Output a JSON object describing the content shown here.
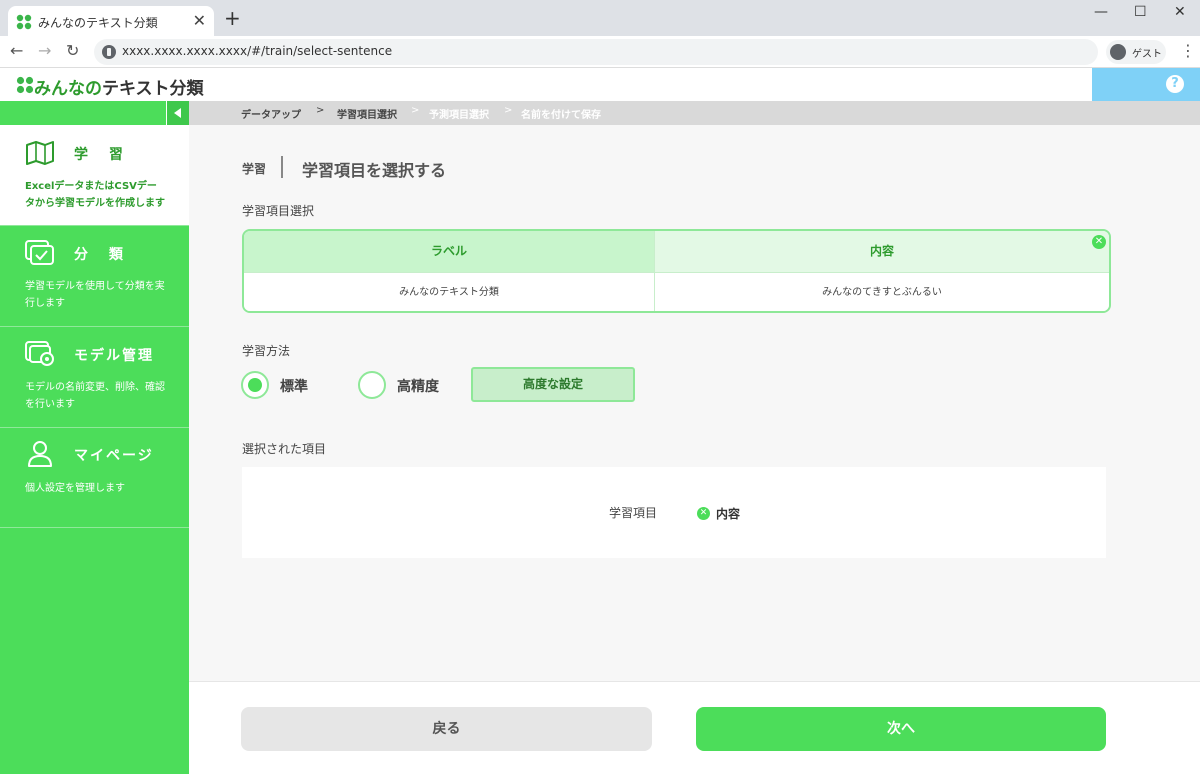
{
  "browser": {
    "tab_title": "みんなのテキスト分類",
    "tab_close": "✕",
    "new_tab": "+",
    "url": "xxxx.xxxx.xxxx.xxxx/#/train/select-sentence",
    "profile_label": "ゲスト",
    "minimize": "—",
    "maximize": "☐",
    "close": "✕",
    "back": "←",
    "forward": "→",
    "reload": "↻",
    "menu": "⋮"
  },
  "app": {
    "logo_hiragana": "みんなの",
    "logo_katakana": "テキスト分類",
    "help": "?"
  },
  "sidebar": {
    "items": [
      {
        "title": "学 習",
        "desc": "ExcelデータまたはCSVデータから学習モデルを作成します",
        "icon": "book-icon"
      },
      {
        "title": "分 類",
        "desc": "学習モデルを使用して分類を実行します",
        "icon": "classify-icon"
      },
      {
        "title": "モデル管理",
        "desc": "モデルの名前変更、削除、確認を行います",
        "icon": "model-settings-icon"
      },
      {
        "title": "マイページ",
        "desc": "個人設定を管理します",
        "icon": "user-icon"
      }
    ]
  },
  "breadcrumb": {
    "steps": [
      "データアップ",
      "学習項目選択",
      "予測項目選択",
      "名前を付けて保存"
    ],
    "sep": ">"
  },
  "page": {
    "section": "学習",
    "title": "学習項目を選択する"
  },
  "select_section": {
    "label": "学習項目選択",
    "columns": [
      {
        "header": "ラベル",
        "value": "みんなのテキスト分類"
      },
      {
        "header": "内容",
        "value": "みんなのてきすとぶんるい"
      }
    ],
    "remove": "✕"
  },
  "method": {
    "label": "学習方法",
    "options": [
      {
        "label": "標準",
        "checked": true
      },
      {
        "label": "高精度",
        "checked": false
      }
    ],
    "advanced": "高度な設定"
  },
  "selected": {
    "label": "選択された項目",
    "key": "学習項目",
    "value": "内容",
    "remove": "✕"
  },
  "footer": {
    "back": "戻る",
    "next": "次へ"
  },
  "colors": {
    "primary": "#4cdd5a",
    "primary_dark": "#2d9b2d",
    "help_blue": "#7fd1f7"
  }
}
